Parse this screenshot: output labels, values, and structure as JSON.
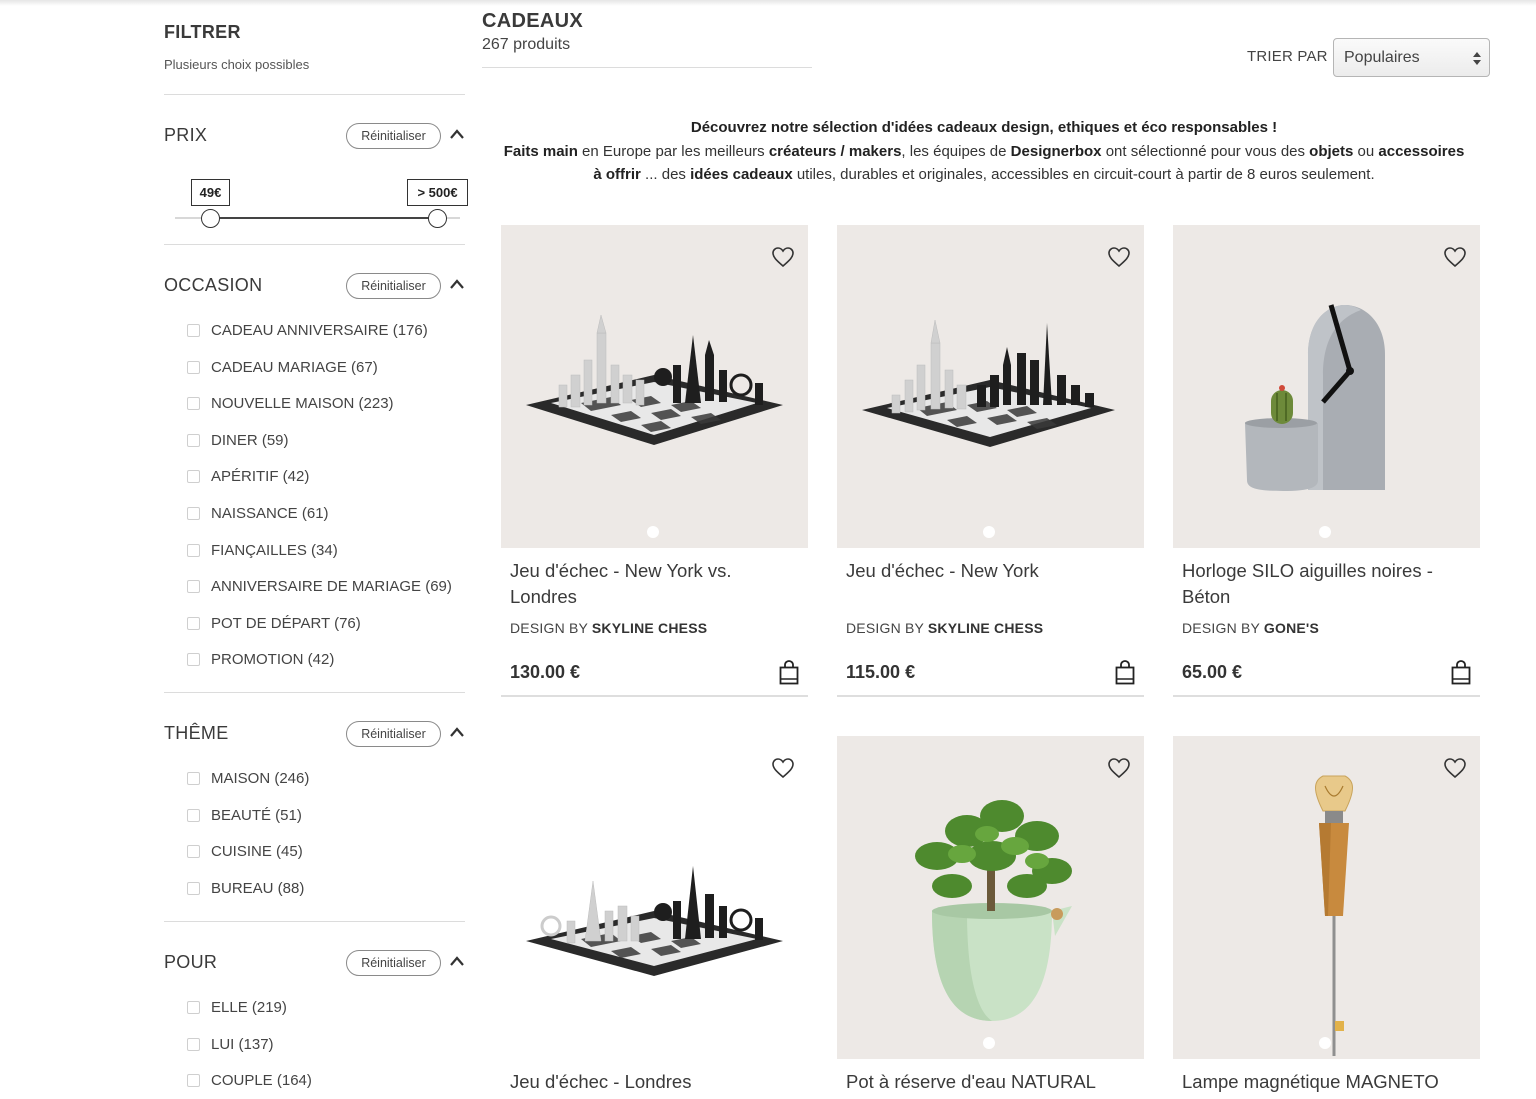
{
  "sidebar": {
    "title": "FILTRER",
    "subtitle": "Plusieurs choix possibles",
    "reset_label": "Réinitialiser",
    "price": {
      "title": "PRIX",
      "min_label": "49€",
      "max_label": "> 500€"
    },
    "occasion": {
      "title": "OCCASION",
      "options": [
        "CADEAU ANNIVERSAIRE (176)",
        "CADEAU MARIAGE (67)",
        "NOUVELLE MAISON (223)",
        "DINER (59)",
        "APÉRITIF (42)",
        "NAISSANCE (61)",
        "FIANÇAILLES (34)",
        "ANNIVERSAIRE DE MARIAGE (69)",
        "POT DE DÉPART (76)",
        "PROMOTION (42)"
      ]
    },
    "theme": {
      "title": "THÊME",
      "options": [
        "MAISON (246)",
        "BEAUTÉ (51)",
        "CUISINE (45)",
        "BUREAU (88)"
      ]
    },
    "pour": {
      "title": "POUR",
      "options": [
        "ELLE (219)",
        "LUI (137)",
        "COUPLE (164)"
      ]
    }
  },
  "main": {
    "title": "CADEAUX",
    "count": "267 produits",
    "sort_label": "TRIER PAR",
    "sort_value": "Populaires",
    "intro": {
      "line1": "Découvrez notre sélection d'idées cadeaux design, ethiques et éco responsables !",
      "p1": "Faits main",
      "p2": " en Europe par les meilleurs ",
      "p3": "créateurs / makers",
      "p4": ", les équipes de ",
      "p5": "Designerbox",
      "p6": " ont sélectionné pour vous des ",
      "p7": "objets",
      "p8": " ou ",
      "p9": "accessoires à offrir",
      "p10": " ... des ",
      "p11": "idées cadeaux",
      "p12": " utiles, durables et originales, accessibles en circuit-court à partir de 8 euros seulement."
    },
    "designer_prefix": "DESIGN BY ",
    "products": [
      {
        "name": "Jeu d'échec - New York vs. Londres",
        "designer": "SKYLINE CHESS",
        "price": "130.00 €"
      },
      {
        "name": "Jeu d'échec - New York",
        "designer": "SKYLINE CHESS",
        "price": "115.00 €"
      },
      {
        "name": "Horloge SILO aiguilles noires - Béton",
        "designer": "GONE'S",
        "price": "65.00 €"
      },
      {
        "name": "Jeu d'échec - Londres"
      },
      {
        "name": "Pot à réserve d'eau NATURAL"
      },
      {
        "name": "Lampe magnétique MAGNETO"
      }
    ]
  },
  "icons": {
    "favorite": "heart-outline-icon",
    "cart": "shopping-bag-icon",
    "collapse": "chevron-up-icon",
    "sort": "select-arrows-icon"
  },
  "colors": {
    "image_bg": "#ede9e6",
    "text": "#333333",
    "separator": "#dcdcdc"
  }
}
